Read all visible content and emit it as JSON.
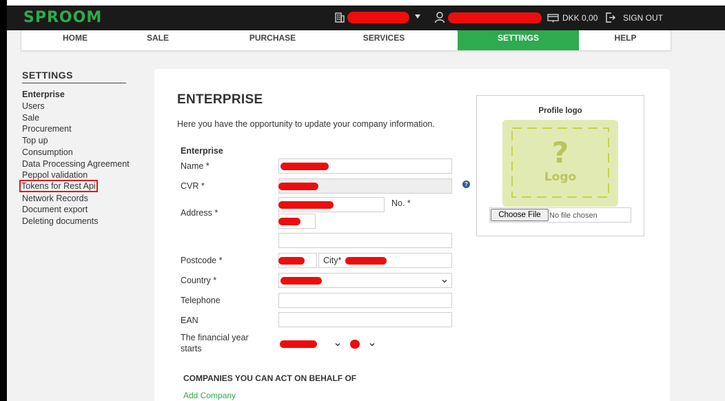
{
  "brand": {
    "logo_text": "SPROOM",
    "color": "#2faa4a"
  },
  "topbar": {
    "balance": "DKK 0,00",
    "signout_label": "SIGN OUT",
    "icons": [
      "building-icon",
      "user-icon",
      "wallet-icon",
      "signout-icon"
    ]
  },
  "nav": {
    "items": [
      "HOME",
      "SALE",
      "PURCHASE",
      "SERVICES",
      "SETTINGS",
      "HELP"
    ],
    "active": "SETTINGS",
    "active_color": "#2eaa4f"
  },
  "sidebar": {
    "title": "SETTINGS",
    "items": [
      "Enterprise",
      "Users",
      "Sale",
      "Procurement",
      "Top up",
      "Consumption",
      "Data Processing Agreement",
      "Peppol validation",
      "Tokens for Rest Api",
      "Network Records",
      "Document export",
      "Deleting documents"
    ],
    "current": "Enterprise",
    "highlighted": "Tokens for Rest Api"
  },
  "main": {
    "title": "ENTERPRISE",
    "intro": "Here you have the opportunity to update your company information.",
    "section_title": "Enterprise",
    "fields": {
      "name": "Name *",
      "cvr": "CVR *",
      "address": "Address *",
      "number": "No. *",
      "postcode": "Postcode *",
      "city": "City*",
      "country": "Country *",
      "telephone": "Telephone",
      "ean": "EAN",
      "financial_year": "The financial year starts"
    },
    "help_icon": "?",
    "companies_title": "COMPANIES YOU CAN ACT ON BEHALF OF",
    "add_company": "Add Company"
  },
  "profile_logo": {
    "title": "Profile logo",
    "placeholder_mark": "?",
    "placeholder_text": "Logo",
    "choose_file": "Choose File",
    "no_file": "No file chosen"
  }
}
